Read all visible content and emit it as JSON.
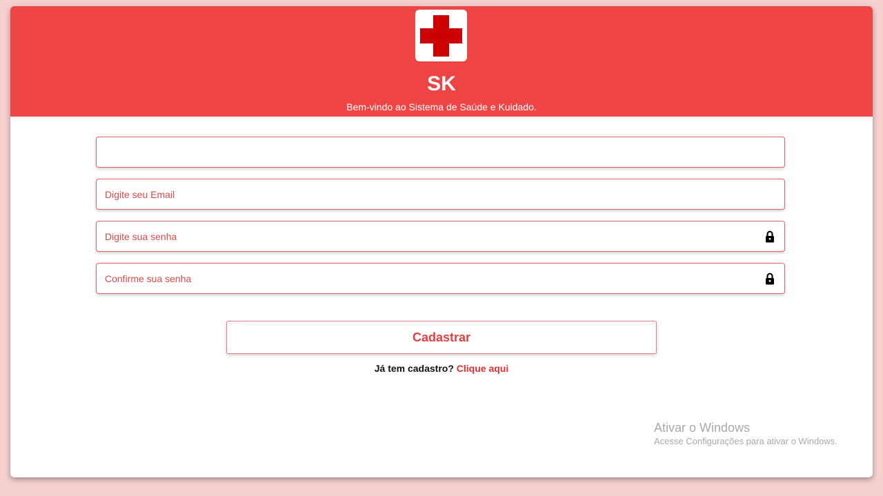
{
  "header": {
    "brand": "SK",
    "subtitle": "Bem-vindo ao Sistema de Saúde e Kuidado.",
    "logo_icon": "red-cross-icon",
    "background_color": "#ef4444"
  },
  "form": {
    "name_field": {
      "placeholder": "",
      "value": ""
    },
    "email_field": {
      "placeholder": "Digite seu Email",
      "value": ""
    },
    "password_field": {
      "placeholder": "Digite sua senha",
      "value": "",
      "icon": "lock-icon"
    },
    "confirm_password_field": {
      "placeholder": "Confirme sua senha",
      "value": "",
      "icon": "lock-icon"
    },
    "submit_label": "Cadastrar"
  },
  "login_prompt": {
    "text": "Já tem cadastro?",
    "link_label": "Clique aqui"
  },
  "watermark": {
    "title": "Ativar o Windows",
    "subtitle": "Acesse Configurações para ativar o Windows."
  }
}
